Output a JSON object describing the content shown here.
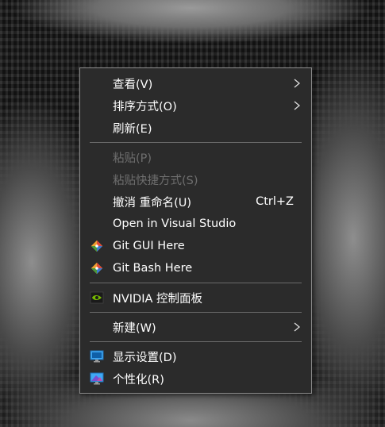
{
  "menu": {
    "items": [
      {
        "label": "查看(V)",
        "has_submenu": true
      },
      {
        "label": "排序方式(O)",
        "has_submenu": true
      },
      {
        "label": "刷新(E)"
      },
      {
        "label": "粘贴(P)",
        "disabled": true
      },
      {
        "label": "粘贴快捷方式(S)",
        "disabled": true
      },
      {
        "label": "撤消 重命名(U)",
        "shortcut": "Ctrl+Z"
      },
      {
        "label": "Open in Visual Studio"
      },
      {
        "label": "Git GUI Here",
        "icon": "git-icon"
      },
      {
        "label": "Git Bash Here",
        "icon": "git-icon"
      },
      {
        "label": "NVIDIA 控制面板",
        "icon": "nvidia-icon"
      },
      {
        "label": "新建(W)",
        "has_submenu": true
      },
      {
        "label": "显示设置(D)",
        "icon": "display-icon"
      },
      {
        "label": "个性化(R)",
        "icon": "personalize-icon"
      }
    ]
  },
  "colors": {
    "menu_bg": "#2b2b2b",
    "text": "#ffffff",
    "disabled_text": "#6e6e6e",
    "separator": "#6a6a6a"
  }
}
